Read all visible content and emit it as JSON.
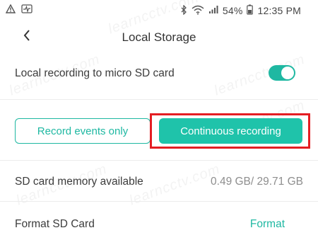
{
  "status_bar": {
    "battery": "54%",
    "time": "12:35 PM",
    "icons": [
      "warning-icon",
      "activity-icon",
      "bluetooth-icon",
      "wifi-icon",
      "signal-icon",
      "battery-icon"
    ]
  },
  "header": {
    "title": "Local Storage",
    "back_icon": "back-chevron-icon"
  },
  "settings": {
    "local_recording_label": "Local recording to micro SD card",
    "local_recording_enabled": true,
    "record_events_label": "Record events only",
    "continuous_label": "Continuous recording",
    "selected_mode": "Continuous recording",
    "sd_memory_label": "SD card memory available",
    "sd_memory_value": "0.49 GB/ 29.71 GB",
    "format_label": "Format SD Card",
    "format_action": "Format"
  },
  "watermark": {
    "text": "learncctv.com"
  },
  "colors": {
    "accent": "#1fb8a2",
    "highlight": "#e41e23",
    "muted_text": "#8e8e8e"
  }
}
